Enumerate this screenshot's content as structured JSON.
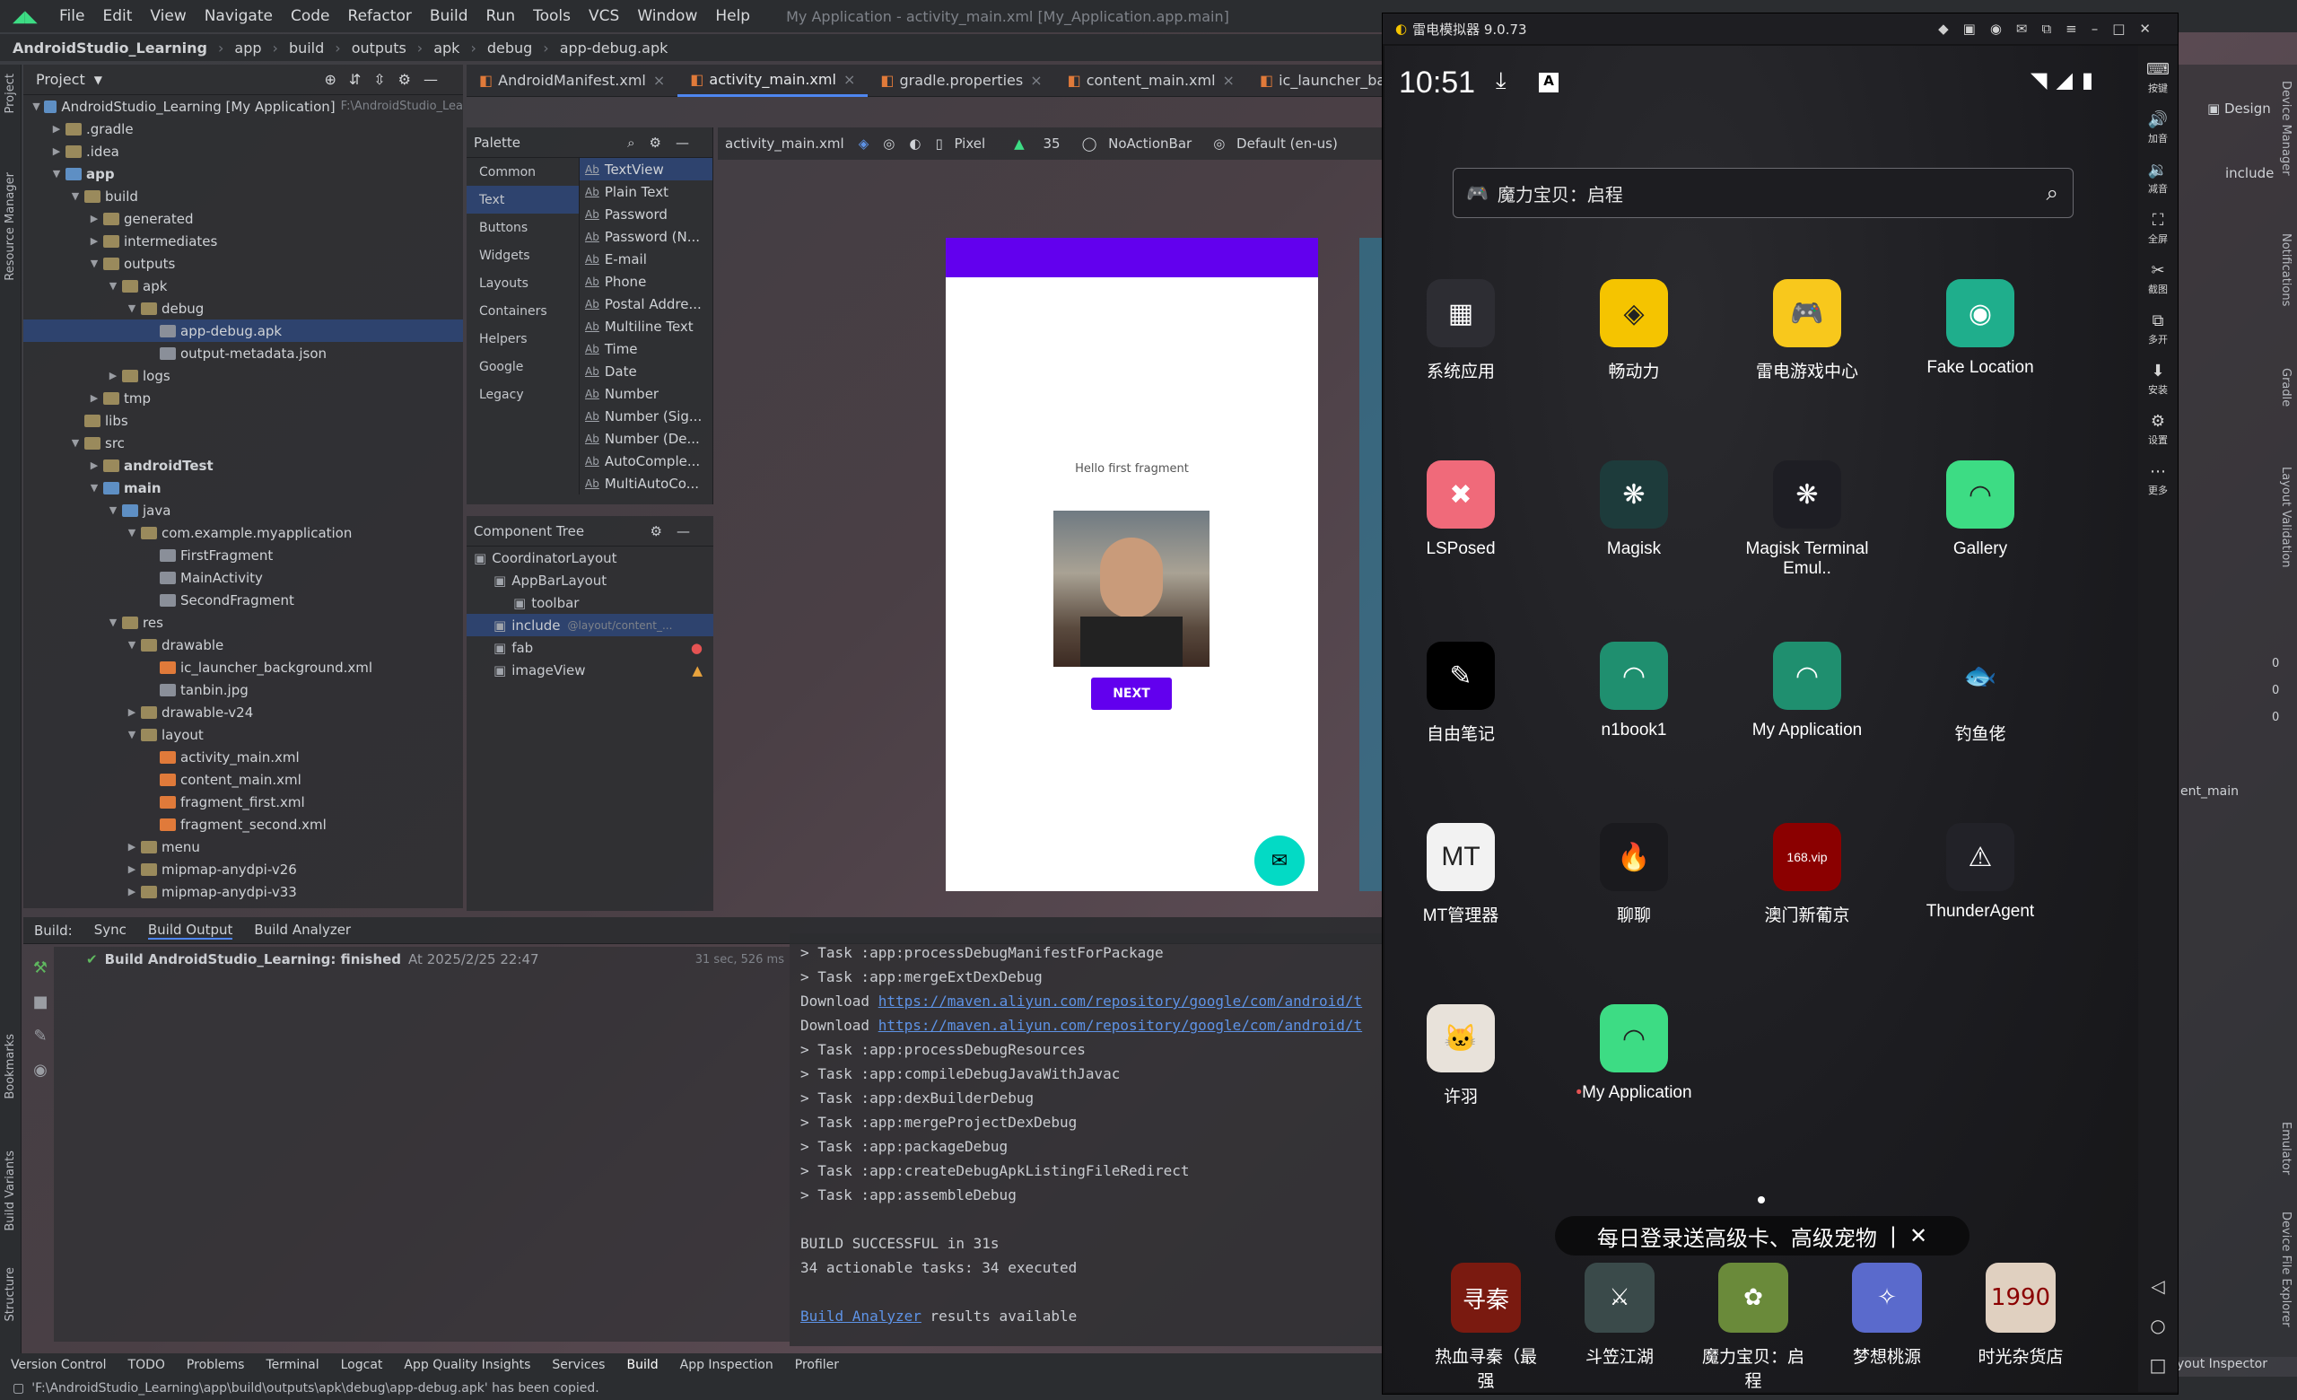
{
  "menu": {
    "items": [
      "File",
      "Edit",
      "View",
      "Navigate",
      "Code",
      "Refactor",
      "Build",
      "Run",
      "Tools",
      "VCS",
      "Window",
      "Help"
    ],
    "window_title": "My Application - activity_main.xml [My_Application.app.main]"
  },
  "breadcrumb": [
    "AndroidStudio_Learning",
    "app",
    "build",
    "outputs",
    "apk",
    "debug",
    "app-debug.apk"
  ],
  "left_strip": {
    "project": "Project",
    "resource_manager": "Resource Manager",
    "bookmarks": "Bookmarks",
    "build_variants": "Build Variants",
    "structure": "Structure"
  },
  "project": {
    "header": "Project",
    "tree": [
      {
        "level": 0,
        "label": "AndroidStudio_Learning [My Application]",
        "hint": "F:\\AndroidStudio_Lea",
        "kind": "folderb",
        "open": true
      },
      {
        "level": 1,
        "label": ".gradle",
        "kind": "folder",
        "open": false
      },
      {
        "level": 1,
        "label": ".idea",
        "kind": "folder",
        "open": false
      },
      {
        "level": 1,
        "label": "app",
        "kind": "folderb",
        "open": true,
        "bold": true
      },
      {
        "level": 2,
        "label": "build",
        "kind": "folder",
        "open": true
      },
      {
        "level": 3,
        "label": "generated",
        "kind": "folder",
        "open": false
      },
      {
        "level": 3,
        "label": "intermediates",
        "kind": "folder",
        "open": false
      },
      {
        "level": 3,
        "label": "outputs",
        "kind": "folder",
        "open": true
      },
      {
        "level": 4,
        "label": "apk",
        "kind": "folder",
        "open": true
      },
      {
        "level": 5,
        "label": "debug",
        "kind": "folder",
        "open": true
      },
      {
        "level": 6,
        "label": "app-debug.apk",
        "kind": "file",
        "selected": true
      },
      {
        "level": 6,
        "label": "output-metadata.json",
        "kind": "file"
      },
      {
        "level": 4,
        "label": "logs",
        "kind": "folder",
        "open": false
      },
      {
        "level": 3,
        "label": "tmp",
        "kind": "folder",
        "open": false
      },
      {
        "level": 2,
        "label": "libs",
        "kind": "folder"
      },
      {
        "level": 2,
        "label": "src",
        "kind": "folder",
        "open": true
      },
      {
        "level": 3,
        "label": "androidTest",
        "kind": "folder",
        "open": false,
        "bold": true
      },
      {
        "level": 3,
        "label": "main",
        "kind": "folderb",
        "open": true,
        "bold": true
      },
      {
        "level": 4,
        "label": "java",
        "kind": "folderb",
        "open": true
      },
      {
        "level": 5,
        "label": "com.example.myapplication",
        "kind": "folder",
        "open": true
      },
      {
        "level": 6,
        "label": "FirstFragment",
        "kind": "file"
      },
      {
        "level": 6,
        "label": "MainActivity",
        "kind": "file"
      },
      {
        "level": 6,
        "label": "SecondFragment",
        "kind": "file"
      },
      {
        "level": 4,
        "label": "res",
        "kind": "folder",
        "open": true
      },
      {
        "level": 5,
        "label": "drawable",
        "kind": "folder",
        "open": true
      },
      {
        "level": 6,
        "label": "ic_launcher_background.xml",
        "kind": "xml"
      },
      {
        "level": 6,
        "label": "tanbin.jpg",
        "kind": "file"
      },
      {
        "level": 5,
        "label": "drawable-v24",
        "kind": "folder",
        "open": false
      },
      {
        "level": 5,
        "label": "layout",
        "kind": "folder",
        "open": true
      },
      {
        "level": 6,
        "label": "activity_main.xml",
        "kind": "xml"
      },
      {
        "level": 6,
        "label": "content_main.xml",
        "kind": "xml"
      },
      {
        "level": 6,
        "label": "fragment_first.xml",
        "kind": "xml"
      },
      {
        "level": 6,
        "label": "fragment_second.xml",
        "kind": "xml"
      },
      {
        "level": 5,
        "label": "menu",
        "kind": "folder",
        "open": false
      },
      {
        "level": 5,
        "label": "mipmap-anydpi-v26",
        "kind": "folder",
        "open": false
      },
      {
        "level": 5,
        "label": "mipmap-anydpi-v33",
        "kind": "folder",
        "open": false
      }
    ]
  },
  "editor_tabs": [
    "AndroidManifest.xml",
    "activity_main.xml",
    "gradle.properties",
    "content_main.xml",
    "ic_launcher_background.xml"
  ],
  "active_tab": "activity_main.xml",
  "palette": {
    "title": "Palette",
    "categories": [
      "Common",
      "Text",
      "Buttons",
      "Widgets",
      "Layouts",
      "Containers",
      "Helpers",
      "Google",
      "Legacy"
    ],
    "selected_category": "Text",
    "items": [
      "TextView",
      "Plain Text",
      "Password",
      "Password (N...",
      "E-mail",
      "Phone",
      "Postal Addre...",
      "Multiline Text",
      "Time",
      "Date",
      "Number",
      "Number (Sig...",
      "Number (De...",
      "AutoComple...",
      "MultiAutoCo..."
    ]
  },
  "design_toolbar": {
    "file": "activity_main.xml",
    "device": "Pixel",
    "api": "35",
    "theme": "NoActionBar",
    "locale": "Default (en-us)"
  },
  "component_tree": {
    "title": "Component Tree",
    "items": [
      {
        "level": 0,
        "label": "CoordinatorLayout"
      },
      {
        "level": 1,
        "label": "AppBarLayout"
      },
      {
        "level": 2,
        "label": "toolbar"
      },
      {
        "level": 1,
        "label": "include",
        "hint": "@layout/content_...",
        "selected": true
      },
      {
        "level": 1,
        "label": "fab",
        "status": "error"
      },
      {
        "level": 1,
        "label": "imageView",
        "status": "warning"
      }
    ]
  },
  "preview": {
    "hello": "Hello first fragment",
    "next": "NEXT"
  },
  "build_bar": {
    "label": "Build:",
    "tabs": [
      "Sync",
      "Build Output",
      "Build Analyzer"
    ],
    "active": "Build Output"
  },
  "build_result": {
    "text": "Build AndroidStudio_Learning: finished",
    "time": "At 2025/2/25 22:47",
    "duration": "31 sec, 526 ms"
  },
  "console": [
    "> Task :app:processDebugManifestForPackage",
    "> Task :app:mergeExtDexDebug",
    {
      "prefix": "Download ",
      "link": "https://maven.aliyun.com/repository/google/com/android/t"
    },
    {
      "prefix": "Download ",
      "link": "https://maven.aliyun.com/repository/google/com/android/t"
    },
    "> Task :app:processDebugResources",
    "> Task :app:compileDebugJavaWithJavac",
    "> Task :app:dexBuilderDebug",
    "> Task :app:mergeProjectDexDebug",
    "> Task :app:packageDebug",
    "> Task :app:createDebugApkListingFileRedirect",
    "> Task :app:assembleDebug",
    "",
    "BUILD SUCCESSFUL in 31s",
    "34 actionable tasks: 34 executed",
    "",
    {
      "prefix": "",
      "link": "Build Analyzer",
      "suffix": " results available"
    }
  ],
  "statusbar": [
    "Version Control",
    "TODO",
    "Problems",
    "Terminal",
    "Logcat",
    "App Quality Insights",
    "Services",
    "Build",
    "App Inspection",
    "Profiler"
  ],
  "message": "'F:\\AndroidStudio_Learning\\app\\build\\outputs\\apk\\debug\\app-debug.apk' has been copied.",
  "ide_right": {
    "design": "Design",
    "include": "include",
    "content_main": "ent_main",
    "layout_inspector": "yout Inspector",
    "zero": "0",
    "side": [
      "Device Manager",
      "Notifications",
      "Gradle",
      "Layout Validation",
      "Emulator",
      "Device File Explorer"
    ]
  },
  "emulator": {
    "title": "雷电模拟器 9.0.73",
    "clock": "10:51",
    "search": "魔力宝贝：启程",
    "side_buttons": [
      "按键",
      "加音",
      "减音",
      "全屏",
      "截图",
      "多开",
      "安装",
      "设置",
      "更多"
    ],
    "apps": [
      {
        "label": "系统应用",
        "bg": "#2d2d33",
        "glyph": "▦"
      },
      {
        "label": "畅动力",
        "bg": "#f5c400",
        "glyph": "◈"
      },
      {
        "label": "雷电游戏中心",
        "bg": "#f8c81c",
        "glyph": "🎮"
      },
      {
        "label": "Fake Location",
        "bg": "#1fae8c",
        "glyph": "◉"
      },
      {
        "label": "LSPosed",
        "bg": "#f06a7a",
        "glyph": "✖"
      },
      {
        "label": "Magisk",
        "bg": "#1d3b3b",
        "glyph": "❋"
      },
      {
        "label": "Magisk Terminal Emul..",
        "bg": "#1e1e24",
        "glyph": "❋"
      },
      {
        "label": "Gallery",
        "bg": "#3ddc84",
        "glyph": "◠"
      },
      {
        "label": "自由笔记",
        "bg": "#000000",
        "glyph": "✎"
      },
      {
        "label": "n1book1",
        "bg": "#1f8f6f",
        "glyph": "◠"
      },
      {
        "label": "My Application",
        "bg": "#1f8f6f",
        "glyph": "◠"
      },
      {
        "label": "钓鱼佬",
        "bg": "transparent",
        "glyph": "🐟"
      },
      {
        "label": "MT管理器",
        "bg": "#f2f2f2",
        "glyph": "MT"
      },
      {
        "label": "聊聊",
        "bg": "#1a1a1e",
        "glyph": "🔥"
      },
      {
        "label": "澳门新葡京",
        "bg": "#8b0000",
        "glyph": "168.vip"
      },
      {
        "label": "ThunderAgent",
        "bg": "#222228",
        "glyph": "⚠"
      },
      {
        "label": "许羽",
        "bg": "#e8e2da",
        "glyph": "🐱"
      },
      {
        "label": "My Application",
        "bg": "#3ddc84",
        "glyph": "◠",
        "dot": true
      }
    ],
    "toast": "每日登录送高级卡、高级宠物",
    "dock": [
      {
        "label": "热血寻秦（最强",
        "bg": "#7a1a10",
        "glyph": "寻秦"
      },
      {
        "label": "斗笠江湖",
        "bg": "#3a4a4a",
        "glyph": "⚔"
      },
      {
        "label": "魔力宝贝：启程",
        "bg": "#6a8a3a",
        "glyph": "✿"
      },
      {
        "label": "梦想桃源",
        "bg": "#5a6acc",
        "glyph": "✧"
      },
      {
        "label": "时光杂货店",
        "bg": "#e0d0c0",
        "glyph": "1990"
      }
    ]
  }
}
